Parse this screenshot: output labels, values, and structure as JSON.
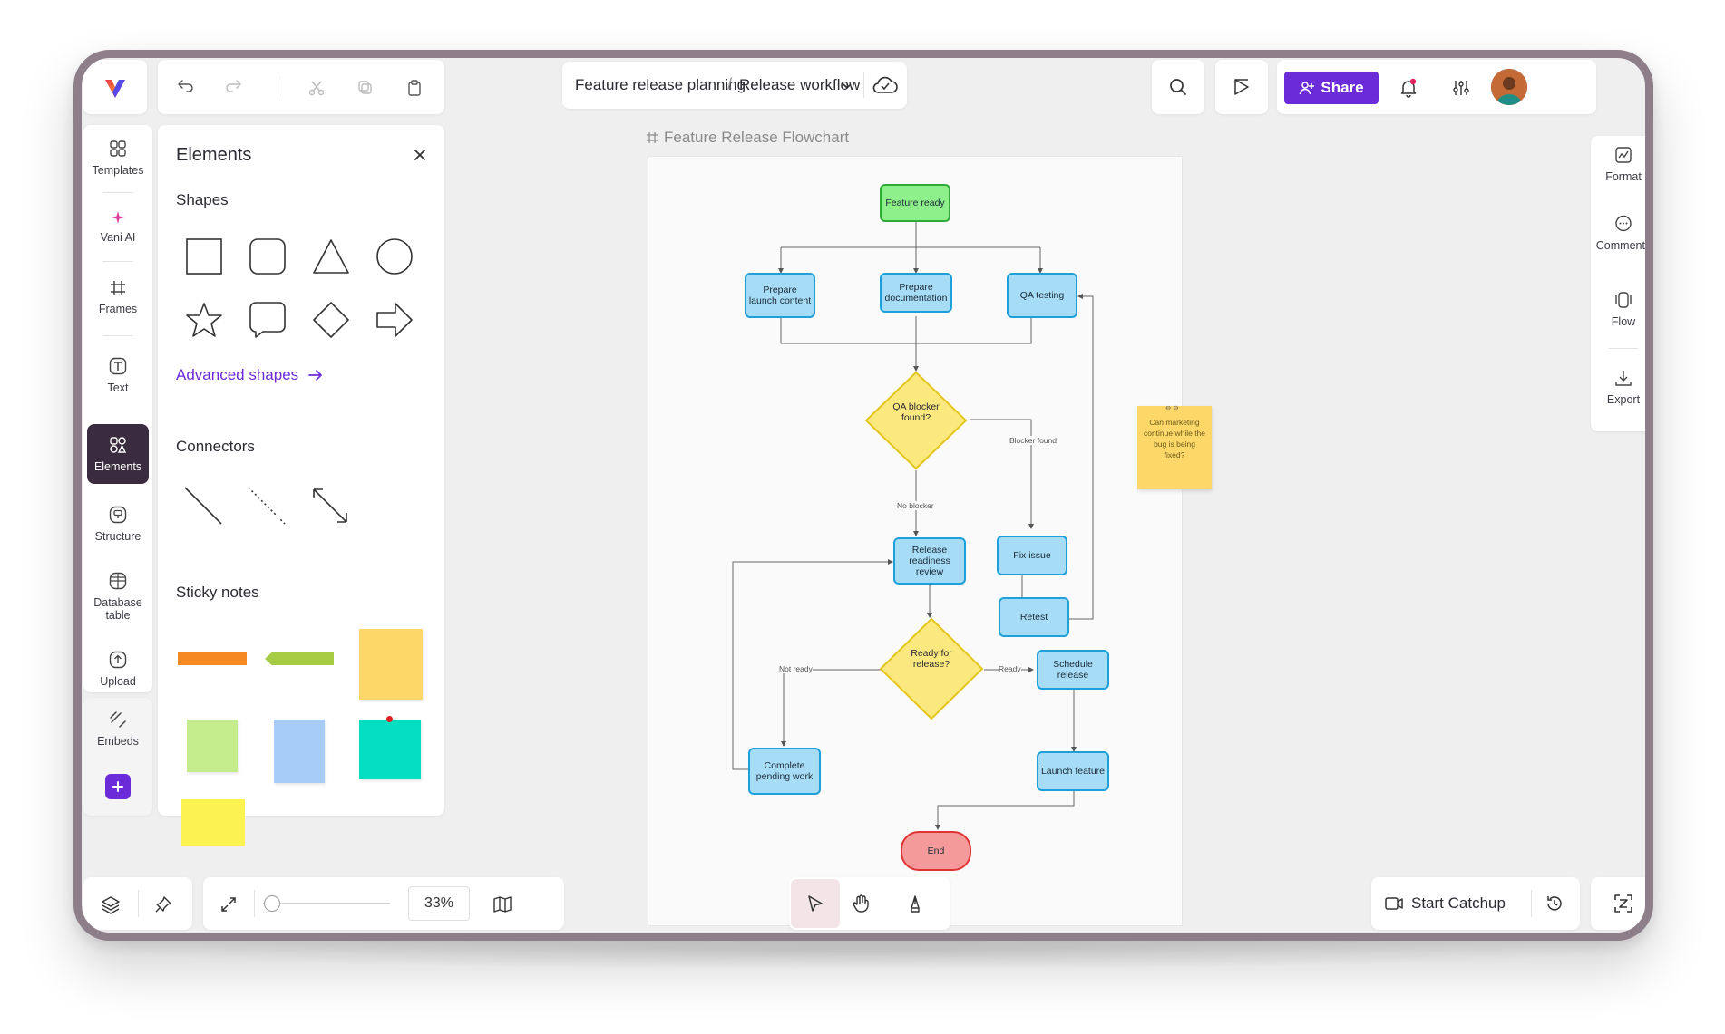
{
  "header": {
    "breadcrumb_project": "Feature release planning",
    "breadcrumb_sep": "/",
    "breadcrumb_page": "Release workflow",
    "share_label": "Share"
  },
  "rail": {
    "items": [
      {
        "label": "Templates",
        "icon": "templates-icon"
      },
      {
        "label": "Vani AI",
        "icon": "sparkle-icon"
      },
      {
        "label": "Frames",
        "icon": "frame-icon"
      },
      {
        "label": "Text",
        "icon": "text-icon"
      },
      {
        "label": "Elements",
        "icon": "elements-icon",
        "active": true
      },
      {
        "label": "Structure",
        "icon": "structure-icon"
      },
      {
        "label": "Database table",
        "icon": "database-icon"
      },
      {
        "label": "Upload",
        "icon": "upload-icon"
      },
      {
        "label": "Embeds",
        "icon": "embed-icon"
      }
    ]
  },
  "elements_panel": {
    "title": "Elements",
    "shapes_title": "Shapes",
    "advanced_link": "Advanced shapes",
    "connectors_title": "Connectors",
    "sticky_title": "Sticky notes"
  },
  "canvas": {
    "frame_title": "Feature Release Flowchart",
    "sticky_note_text": "Can marketing continue while the bug is being fixed?",
    "nodes": {
      "feature_ready": "Feature ready",
      "prepare_launch": "Prepare launch content",
      "prepare_docs": "Prepare documentation",
      "qa_testing": "QA testing",
      "qa_blocker": "QA blocker found?",
      "fix_issue": "Fix issue",
      "retest": "Retest",
      "release_review": "Release readiness review",
      "ready_release": "Ready for release?",
      "schedule_release": "Schedule release",
      "complete_pending": "Complete pending work",
      "launch_feature": "Launch feature",
      "end": "End"
    },
    "edge_labels": {
      "blocker_found": "Blocker found",
      "no_blocker": "No blocker",
      "not_ready": "Not ready",
      "ready": "Ready"
    }
  },
  "right_panel": {
    "items": [
      {
        "label": "Format",
        "icon": "format-icon"
      },
      {
        "label": "Comments",
        "icon": "comment-icon"
      },
      {
        "label": "Flow",
        "icon": "flow-icon"
      },
      {
        "label": "Export",
        "icon": "export-icon"
      }
    ]
  },
  "bottom": {
    "zoom": "33%",
    "zoom_fraction": 0.05,
    "catchup_label": "Start Catchup"
  },
  "colors": {
    "accent": "#6c2bd9",
    "node_fill": "#a7dcf7",
    "node_stroke": "#1d9fd9",
    "decision_fill": "#fbe97f",
    "start_fill": "#8ef08a",
    "end_fill": "#f59a9a",
    "sticky_yellow": "#fdd868"
  }
}
